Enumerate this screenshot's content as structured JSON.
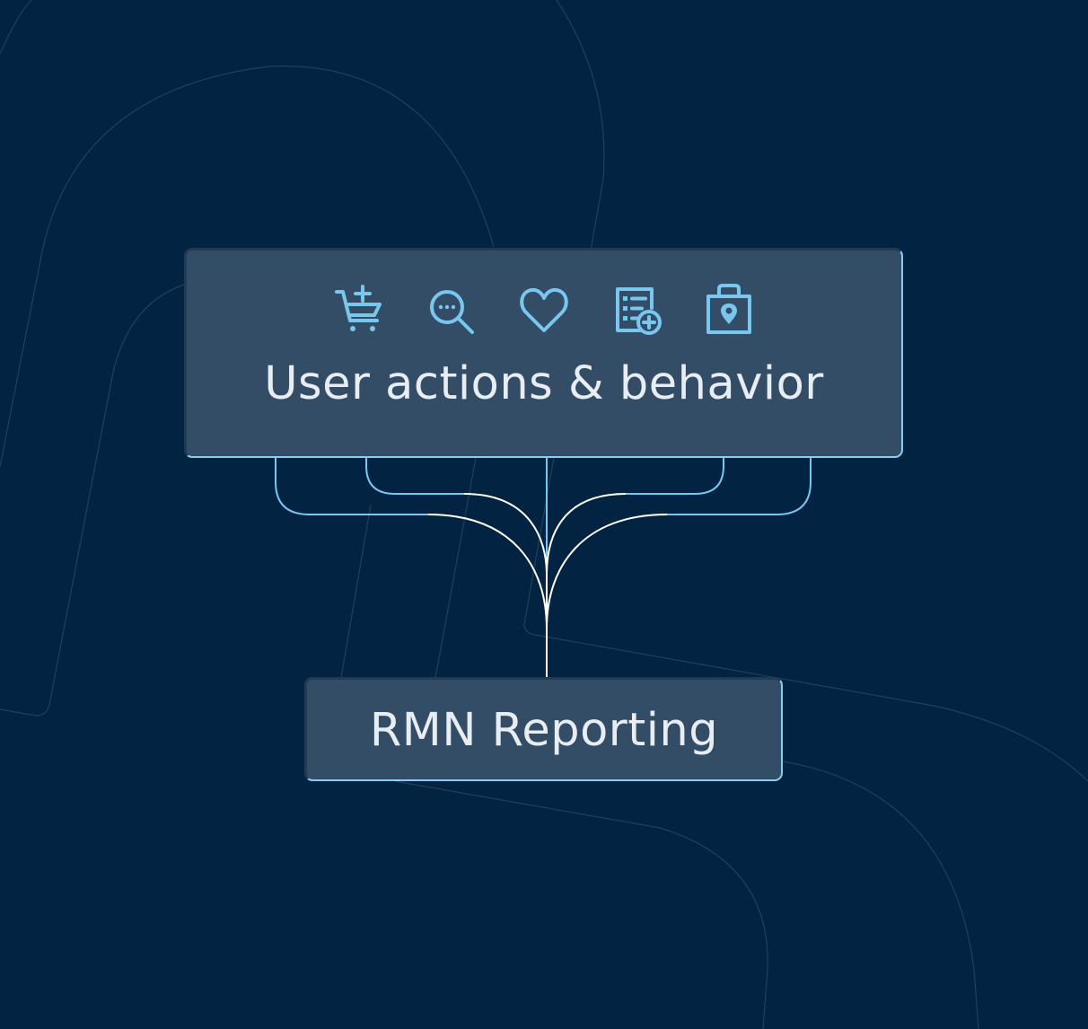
{
  "colors": {
    "background": "#022341",
    "box_fill": "#344d66",
    "accent": "#79c7ef",
    "text": "#e8edf3",
    "connector": "#ffffff"
  },
  "source": {
    "title": "User actions & behavior",
    "icons": [
      "add-to-cart-icon",
      "search-icon",
      "heart-icon",
      "add-to-list-icon",
      "shopping-bag-location-icon"
    ]
  },
  "target": {
    "title": "RMN Reporting"
  }
}
